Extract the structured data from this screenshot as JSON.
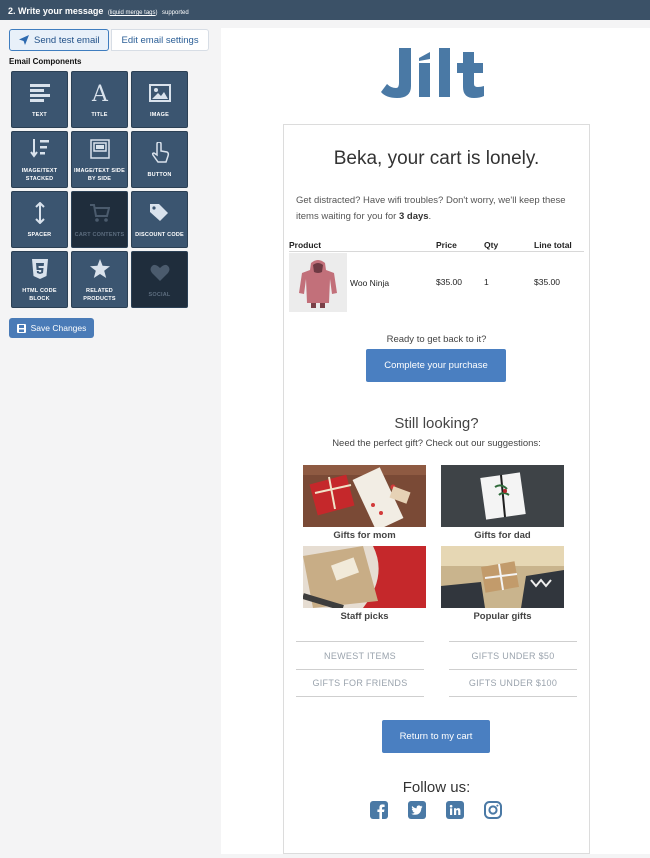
{
  "topbar": {
    "title": "2. Write your message",
    "link": "liquid merge tags",
    "suffix": "supported"
  },
  "toolbar": {
    "send_test_label": "Send test email",
    "edit_settings_label": "Edit email settings",
    "components_title": "Email Components",
    "save_label": "Save Changes"
  },
  "components": [
    {
      "label": "TEXT",
      "icon": "text-lines-icon",
      "enabled": true
    },
    {
      "label": "TITLE",
      "icon": "title-a-icon",
      "enabled": true
    },
    {
      "label": "IMAGE",
      "icon": "image-icon",
      "enabled": true
    },
    {
      "label": "IMAGE/TEXT STACKED",
      "icon": "sort-stacked-icon",
      "enabled": true
    },
    {
      "label": "IMAGE/TEXT SIDE BY SIDE",
      "icon": "side-by-side-icon",
      "enabled": true
    },
    {
      "label": "BUTTON",
      "icon": "pointer-hand-icon",
      "enabled": true
    },
    {
      "label": "SPACER",
      "icon": "vertical-arrows-icon",
      "enabled": true
    },
    {
      "label": "CART CONTENTS",
      "icon": "cart-icon",
      "enabled": false
    },
    {
      "label": "DISCOUNT CODE",
      "icon": "tags-icon",
      "enabled": true
    },
    {
      "label": "HTML CODE BLOCK",
      "icon": "html5-icon",
      "enabled": true
    },
    {
      "label": "RELATED PRODUCTS",
      "icon": "star-icon",
      "enabled": true
    },
    {
      "label": "SOCIAL",
      "icon": "heart-icon",
      "enabled": false
    }
  ],
  "email": {
    "logo_text": "Jilt",
    "headline": "Beka, your cart is lonely.",
    "intro_text": "Get distracted? Have wifi troubles? Don't worry, we'll keep these items waiting for you for ",
    "intro_bold": "3 days",
    "intro_end": ".",
    "table": {
      "headers": {
        "product": "Product",
        "price": "Price",
        "qty": "Qty",
        "line_total": "Line total"
      },
      "rows": [
        {
          "name": "Woo Ninja",
          "price": "$35.00",
          "qty": "1",
          "total": "$35.00"
        }
      ]
    },
    "ready_text": "Ready to get back to it?",
    "cta_label": "Complete your purchase",
    "still_title": "Still looking?",
    "gift_subtitle": "Need the perfect gift? Check out our suggestions:",
    "gifts": [
      {
        "caption": "Gifts for mom"
      },
      {
        "caption": "Gifts for dad"
      },
      {
        "caption": "Staff picks"
      },
      {
        "caption": "Popular gifts"
      }
    ],
    "links_left": [
      "NEWEST ITEMS",
      "GIFTS FOR FRIENDS"
    ],
    "links_right": [
      "GIFTS UNDER $50",
      "GIFTS UNDER $100"
    ],
    "return_label": "Return to my cart",
    "follow_label": "Follow us:",
    "socials": [
      "facebook-icon",
      "twitter-icon",
      "linkedin-icon",
      "instagram-icon"
    ]
  },
  "colors": {
    "topbar": "#3b5167",
    "tile": "#3b5570",
    "tile_disabled": "#1f2d3c",
    "accent": "#4a7fc1",
    "logo": "#4a79a5"
  }
}
